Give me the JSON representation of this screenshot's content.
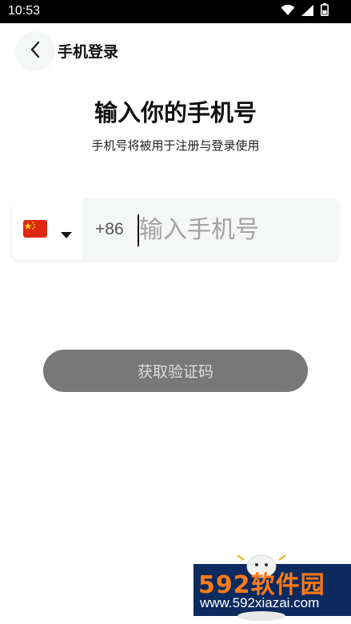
{
  "status_bar": {
    "time": "10:53",
    "icons": [
      "wifi-icon",
      "signal-icon",
      "battery-icon"
    ]
  },
  "header": {
    "back_icon": "chevron-left-icon",
    "title": "手机登录"
  },
  "main": {
    "title": "输入你的手机号",
    "subtitle": "手机号将被用于注册与登录使用"
  },
  "phone_field": {
    "flag_icon": "china-flag-icon",
    "dropdown_icon": "triangle-down-icon",
    "country_code": "+86",
    "value": "",
    "placeholder": "输入手机号"
  },
  "code_button": {
    "label": "获取验证码"
  },
  "watermark": {
    "brand": "592软件园",
    "url": "www.592xiazai.com"
  },
  "colors": {
    "button_bg": "#787878",
    "input_bg": "#f5f6f6",
    "flag_red": "#de2910",
    "flag_yellow": "#ffde00",
    "watermark_bg": "#0c2a5e",
    "watermark_orange": "#ff7a16"
  }
}
